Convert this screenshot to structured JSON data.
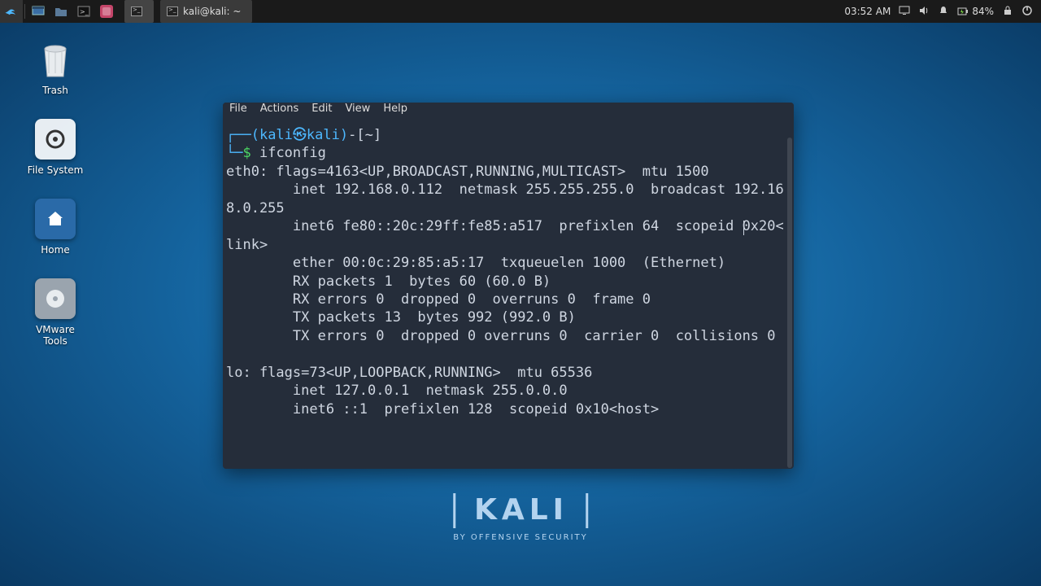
{
  "panel": {
    "task_title": "kali@kali: ~",
    "clock": "03:52 AM",
    "battery": "84%"
  },
  "desktop": {
    "trash": "Trash",
    "filesystem": "File System",
    "home": "Home",
    "vmware": "VMware Tools"
  },
  "terminal": {
    "menus": {
      "file": "File",
      "actions": "Actions",
      "edit": "Edit",
      "view": "View",
      "help": "Help"
    },
    "prompt": {
      "user": "kali",
      "host": "kali",
      "path": "~"
    },
    "command": "ifconfig",
    "output_lines": [
      "eth0: flags=4163<UP,BROADCAST,RUNNING,MULTICAST>  mtu 1500",
      "        inet 192.168.0.112  netmask 255.255.255.0  broadcast 192.168.0.255",
      "        inet6 fe80::20c:29ff:fe85:a517  prefixlen 64  scopeid 0x20<link>",
      "        ether 00:0c:29:85:a5:17  txqueuelen 1000  (Ethernet)",
      "        RX packets 1  bytes 60 (60.0 B)",
      "        RX errors 0  dropped 0  overruns 0  frame 0",
      "        TX packets 13  bytes 992 (992.0 B)",
      "        TX errors 0  dropped 0 overruns 0  carrier 0  collisions 0",
      "",
      "lo: flags=73<UP,LOOPBACK,RUNNING>  mtu 65536",
      "        inet 127.0.0.1  netmask 255.0.0.0",
      "        inet6 ::1  prefixlen 128  scopeid 0x10<host>"
    ]
  },
  "branding": {
    "name": "KALI",
    "tagline": "BY OFFENSIVE SECURITY"
  }
}
